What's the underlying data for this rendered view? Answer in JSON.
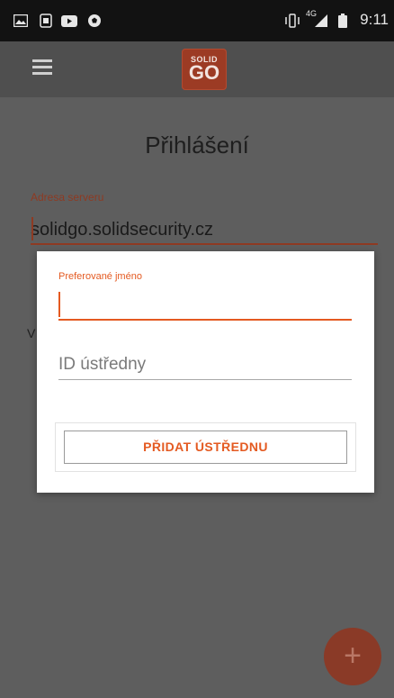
{
  "status_bar": {
    "time": "9:11",
    "network": "4G",
    "notification_icons": [
      "image-notification-icon",
      "sim-notification-icon",
      "youtube-notification-icon",
      "football-notification-icon"
    ],
    "system_icons": [
      "vibrate-icon",
      "signal-icon",
      "battery-icon"
    ]
  },
  "toolbar": {
    "menu_icon": "hamburger-menu-icon",
    "logo": {
      "line1": "SOLID",
      "line2": "GO"
    }
  },
  "page": {
    "title": "Přihlášení",
    "server_label": "Adresa serveru",
    "server_value": "solidgo.solidsecurity.cz",
    "obscured_letter": "V"
  },
  "dialog": {
    "name_label": "Preferované jméno",
    "name_value": "",
    "id_placeholder": "ID ústředny",
    "id_value": "",
    "add_button_label": "PŘIDAT ÚSTŘEDNU"
  },
  "fab": {
    "label": "+"
  },
  "colors": {
    "accent": "#e45a21",
    "brand": "#9c3b24",
    "status_bar": "#121212",
    "toolbar": "#4f4f4f",
    "scrim_background": "#5e5e5e",
    "fab": "#8a3a27"
  }
}
